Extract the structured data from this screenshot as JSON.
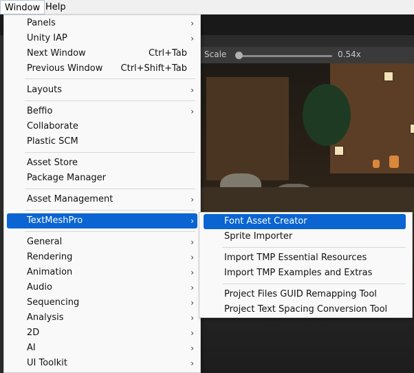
{
  "menubar": {
    "window": "Window",
    "help": "Help"
  },
  "scene": {
    "scale_label": "Scale",
    "scale_value": "0.54x",
    "scale_fraction": 0.03
  },
  "main_menu": {
    "items": [
      {
        "label": "Panels",
        "shortcut": "",
        "submenu": true
      },
      {
        "label": "Unity IAP",
        "shortcut": "",
        "submenu": true
      },
      {
        "label": "Next Window",
        "shortcut": "Ctrl+Tab",
        "submenu": false
      },
      {
        "label": "Previous Window",
        "shortcut": "Ctrl+Shift+Tab",
        "submenu": false
      },
      {
        "label": "Layouts",
        "shortcut": "",
        "submenu": true
      },
      {
        "label": "Beffio",
        "shortcut": "",
        "submenu": true
      },
      {
        "label": "Collaborate",
        "shortcut": "",
        "submenu": false
      },
      {
        "label": "Plastic SCM",
        "shortcut": "",
        "submenu": false
      },
      {
        "label": "Asset Store",
        "shortcut": "",
        "submenu": false
      },
      {
        "label": "Package Manager",
        "shortcut": "",
        "submenu": false
      },
      {
        "label": "Asset Management",
        "shortcut": "",
        "submenu": true
      },
      {
        "label": "TextMeshPro",
        "shortcut": "",
        "submenu": true
      },
      {
        "label": "General",
        "shortcut": "",
        "submenu": true
      },
      {
        "label": "Rendering",
        "shortcut": "",
        "submenu": true
      },
      {
        "label": "Animation",
        "shortcut": "",
        "submenu": true
      },
      {
        "label": "Audio",
        "shortcut": "",
        "submenu": true
      },
      {
        "label": "Sequencing",
        "shortcut": "",
        "submenu": true
      },
      {
        "label": "Analysis",
        "shortcut": "",
        "submenu": true
      },
      {
        "label": "2D",
        "shortcut": "",
        "submenu": true
      },
      {
        "label": "AI",
        "shortcut": "",
        "submenu": true
      },
      {
        "label": "UI Toolkit",
        "shortcut": "",
        "submenu": true
      }
    ],
    "arrow_glyph": "›"
  },
  "submenu": {
    "items": [
      {
        "label": "Font Asset Creator"
      },
      {
        "label": "Sprite Importer"
      },
      {
        "label": "Import TMP Essential Resources"
      },
      {
        "label": "Import TMP Examples and Extras"
      },
      {
        "label": "Project Files GUID Remapping Tool"
      },
      {
        "label": "Project Text Spacing Conversion Tool"
      }
    ]
  },
  "colors": {
    "highlight": "#0a64d2",
    "menu_bg": "#f9f9f9"
  }
}
